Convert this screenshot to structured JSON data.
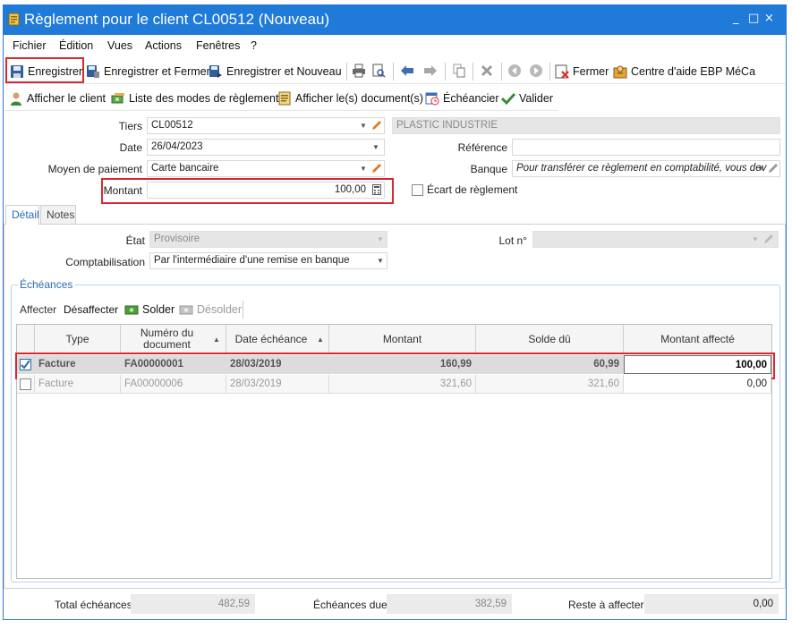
{
  "window": {
    "title": "Règlement pour le client CL00512 (Nouveau)",
    "min": "_",
    "max": "□",
    "close": "×"
  },
  "menu": [
    "Fichier",
    "Édition",
    "Vues",
    "Actions",
    "Fenêtres",
    "?"
  ],
  "toolbar": {
    "save": "Enregistrer",
    "save_close": "Enregistrer et Fermer",
    "save_new": "Enregistrer et Nouveau",
    "close": "Fermer",
    "help": "Centre d'aide EBP MéCa"
  },
  "toolbar2": {
    "show_client": "Afficher le client",
    "payment_modes": "Liste des modes de règlement",
    "show_docs": "Afficher le(s) document(s)",
    "schedule": "Échéancier",
    "validate": "Valider"
  },
  "form": {
    "tiers_label": "Tiers",
    "tiers_value": "CL00512",
    "tiers_name": "PLASTIC INDUSTRIE",
    "date_label": "Date",
    "date_value": "26/04/2023",
    "ref_label": "Référence",
    "ref_value": "",
    "payment_label": "Moyen de paiement",
    "payment_value": "Carte bancaire",
    "bank_label": "Banque",
    "bank_value": "Pour transférer ce règlement en comptabilité, vous dev",
    "amount_label": "Montant",
    "amount_value": "100,00",
    "gap_label": "Écart de règlement"
  },
  "tabs": [
    "Détail",
    "Notes"
  ],
  "detail": {
    "state_label": "État",
    "state_value": "Provisoire",
    "lot_label": "Lot n°",
    "lot_value": "",
    "accounting_label": "Comptabilisation",
    "accounting_value": "Par l'intermédiaire d'une remise en banque"
  },
  "echeances": {
    "title": "Échéances",
    "affecter": "Affecter",
    "desaffecter": "Désaffecter",
    "solder": "Solder",
    "desolder": "Désolder",
    "columns": [
      "Type",
      "Numéro du document",
      "Date échéance",
      "Montant",
      "Solde dû",
      "Montant affecté"
    ],
    "rows": [
      {
        "checked": true,
        "type": "Facture",
        "num": "FA00000001",
        "date": "28/03/2019",
        "montant": "160,99",
        "solde": "60,99",
        "affecte": "100,00"
      },
      {
        "checked": false,
        "type": "Facture",
        "num": "FA00000006",
        "date": "28/03/2019",
        "montant": "321,60",
        "solde": "321,60",
        "affecte": "0,00"
      }
    ]
  },
  "footer": {
    "total_label": "Total échéances",
    "total_value": "482,59",
    "due_label": "Échéances dues",
    "due_value": "382,59",
    "rest_label": "Reste à affecter",
    "rest_value": "0,00"
  },
  "colors": {
    "titlebar": "#1f7ad8",
    "highlight": "#d9282f",
    "accent_text": "#2b6bb3"
  }
}
